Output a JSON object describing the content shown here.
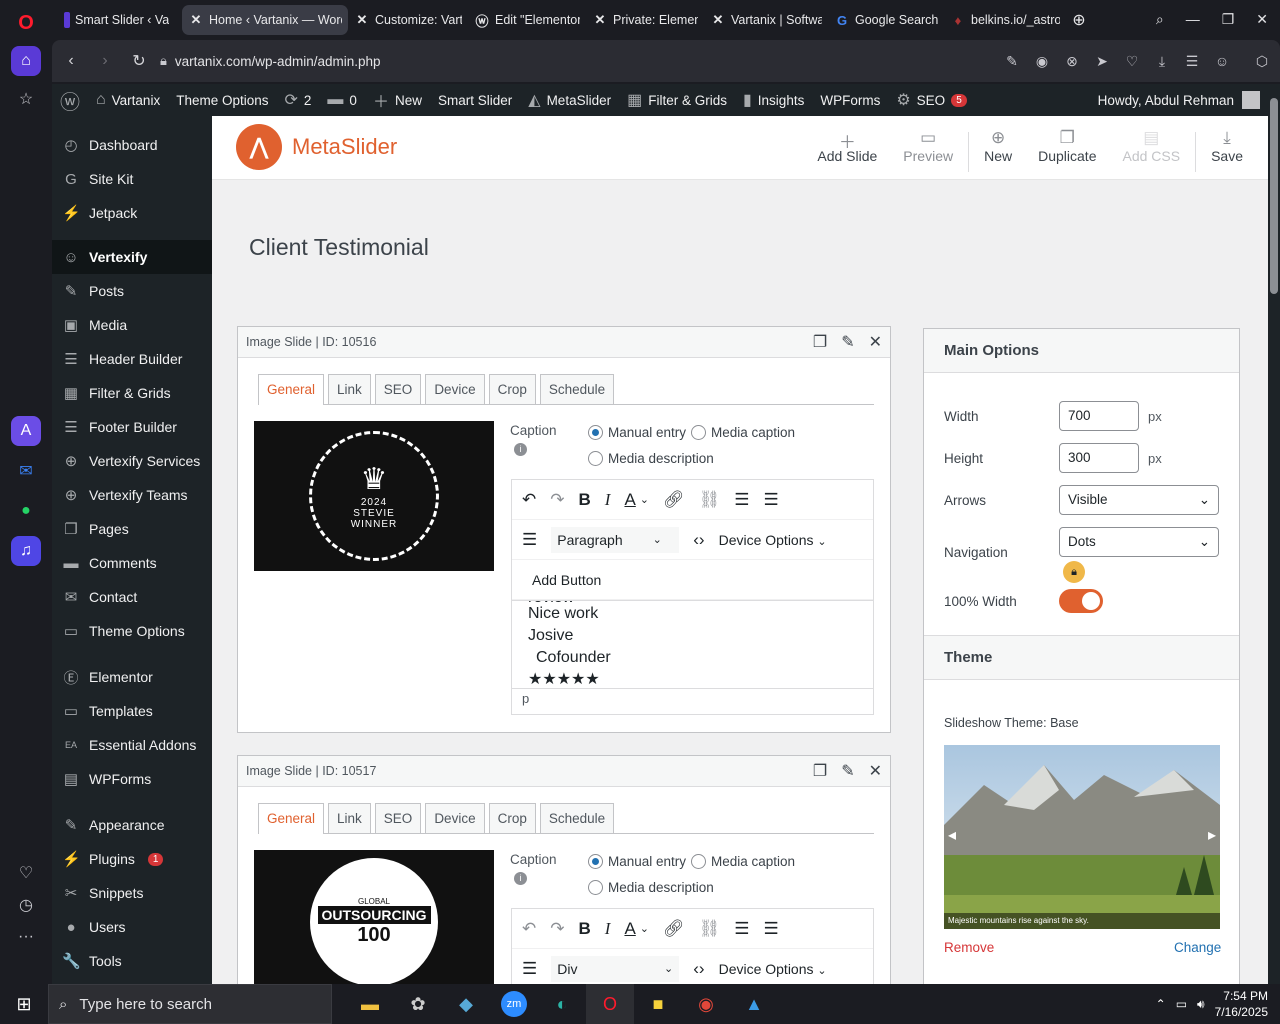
{
  "browser": {
    "tabs": [
      {
        "label": "Smart Slider ‹ Va",
        "icon": "slider-icon"
      },
      {
        "label": "Home ‹ Vartanix — WordP",
        "icon": "vartanix-x-icon"
      },
      {
        "label": "Customize: Varta",
        "icon": "vartanix-x-icon"
      },
      {
        "label": "Edit \"Elementor",
        "icon": "wordpress-icon"
      },
      {
        "label": "Private: Elemento",
        "icon": "vartanix-x-icon"
      },
      {
        "label": "Vartanix | Softwa",
        "icon": "vartanix-x-icon"
      },
      {
        "label": "Google Search",
        "icon": "google-icon"
      },
      {
        "label": "belkins.io/_astro",
        "icon": "belkins-icon"
      }
    ],
    "url": "vartanix.com/wp-admin/admin.php"
  },
  "adminbar": {
    "site": "Vartanix",
    "theme_options": "Theme Options",
    "updates": "2",
    "comments": "0",
    "new": "New",
    "smart_slider": "Smart Slider",
    "metaslider": "MetaSlider",
    "filter_grids": "Filter & Grids",
    "insights": "Insights",
    "wpforms": "WPForms",
    "seo": "SEO",
    "seo_count": "5",
    "howdy": "Howdy, Abdul Rehman"
  },
  "menu": [
    {
      "label": "Dashboard",
      "icon": "dashboard-icon",
      "glyph": "◴"
    },
    {
      "label": "Site Kit",
      "icon": "google-g-icon",
      "glyph": "G"
    },
    {
      "label": "Jetpack",
      "icon": "jetpack-icon",
      "glyph": "⚡"
    },
    {
      "label": "Vertexify",
      "icon": "smile-icon",
      "glyph": "☺",
      "current": true
    },
    {
      "label": "Posts",
      "icon": "pin-icon",
      "glyph": "✎"
    },
    {
      "label": "Media",
      "icon": "media-icon",
      "glyph": "▣"
    },
    {
      "label": "Header Builder",
      "icon": "header-icon",
      "glyph": "☰"
    },
    {
      "label": "Filter & Grids",
      "icon": "grid-icon",
      "glyph": "▦"
    },
    {
      "label": "Footer Builder",
      "icon": "footer-icon",
      "glyph": "☰"
    },
    {
      "label": "Vertexify Services",
      "icon": "plus-circle-icon",
      "glyph": "⊕"
    },
    {
      "label": "Vertexify Teams",
      "icon": "plus-circle-icon",
      "glyph": "⊕"
    },
    {
      "label": "Pages",
      "icon": "pages-icon",
      "glyph": "❐"
    },
    {
      "label": "Comments",
      "icon": "comment-icon",
      "glyph": "▬"
    },
    {
      "label": "Contact",
      "icon": "mail-icon",
      "glyph": "✉"
    },
    {
      "label": "Theme Options",
      "icon": "folder-icon",
      "glyph": "▭"
    },
    {
      "label": "Elementor",
      "icon": "elementor-icon",
      "glyph": "Ⓔ"
    },
    {
      "label": "Templates",
      "icon": "folder-open-icon",
      "glyph": "▭"
    },
    {
      "label": "Essential Addons",
      "icon": "ea-icon",
      "glyph": "EA"
    },
    {
      "label": "WPForms",
      "icon": "wpforms-icon",
      "glyph": "▤"
    },
    {
      "label": "Appearance",
      "icon": "brush-icon",
      "glyph": "✎"
    },
    {
      "label": "Plugins",
      "icon": "plug-icon",
      "glyph": "⚡",
      "badge": "1"
    },
    {
      "label": "Snippets",
      "icon": "scissors-icon",
      "glyph": "✂"
    },
    {
      "label": "Users",
      "icon": "user-icon",
      "glyph": "●"
    },
    {
      "label": "Tools",
      "icon": "wrench-icon",
      "glyph": "🔧"
    }
  ],
  "metaslider": {
    "brand_a": "Meta",
    "brand_b": "Slider",
    "toolbar": {
      "add_slide": "Add Slide",
      "preview": "Preview",
      "new": "New",
      "duplicate": "Duplicate",
      "add_css": "Add CSS",
      "save": "Save"
    },
    "title": "Client Testimonial"
  },
  "slides": [
    {
      "head": "Image Slide | ID: 10516",
      "tabs": [
        "General",
        "Link",
        "SEO",
        "Device",
        "Crop",
        "Schedule"
      ],
      "image_text": "2024 STEVIE WINNER",
      "caption_label": "Caption",
      "opt_manual": "Manual entry",
      "opt_media_caption": "Media caption",
      "opt_media_desc": "Media description",
      "format": "Paragraph",
      "device_options": "Device Options",
      "add_button": "Add Button",
      "body_cut": "review",
      "body_lines": [
        "Nice work",
        "Josive",
        "Cofounder",
        "★★★★★"
      ],
      "status": "p"
    },
    {
      "head": "Image Slide | ID: 10517",
      "tabs": [
        "General",
        "Link",
        "SEO",
        "Device",
        "Crop",
        "Schedule"
      ],
      "image_top": "GLOBAL",
      "image_text": "OUTSOURCING",
      "image_num": "100",
      "caption_label": "Caption",
      "opt_manual": "Manual entry",
      "opt_media_caption": "Media caption",
      "opt_media_desc": "Media description",
      "format": "Div",
      "device_options": "Device Options"
    }
  ],
  "options": {
    "main_title": "Main Options",
    "width_label": "Width",
    "width_value": "700",
    "height_label": "Height",
    "height_value": "300",
    "unit": "px",
    "arrows_label": "Arrows",
    "arrows_value": "Visible",
    "nav_label": "Navigation",
    "nav_value": "Dots",
    "full_width_label": "100% Width",
    "full_width_on": true,
    "theme_title": "Theme",
    "theme_label": "Slideshow Theme: Base",
    "theme_caption": "Majestic mountains rise against the sky.",
    "remove": "Remove",
    "change": "Change"
  },
  "taskbar": {
    "search_placeholder": "Type here to search",
    "time": "7:54 PM",
    "date": "7/16/2025"
  },
  "colors": {
    "accent": "#e0612f",
    "link": "#2271b1",
    "danger": "#d63638"
  }
}
